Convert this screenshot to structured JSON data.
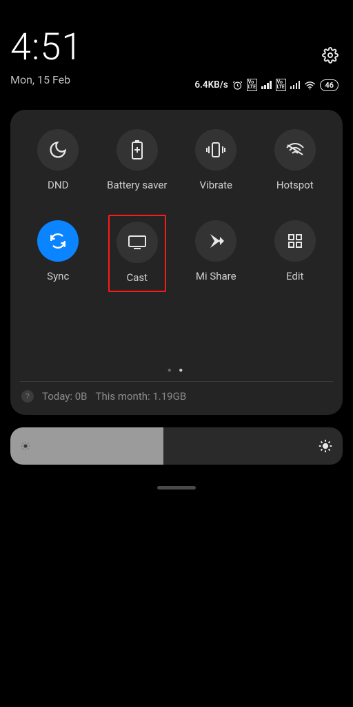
{
  "header": {
    "time": "4:51",
    "date": "Mon, 15 Feb"
  },
  "status": {
    "net_speed": "6.4KB/s",
    "battery": "46"
  },
  "tiles": [
    {
      "id": "dnd",
      "label": "DND",
      "active": false,
      "highlighted": false
    },
    {
      "id": "battery",
      "label": "Battery saver",
      "active": false,
      "highlighted": false
    },
    {
      "id": "vibrate",
      "label": "Vibrate",
      "active": false,
      "highlighted": false
    },
    {
      "id": "hotspot",
      "label": "Hotspot",
      "active": false,
      "highlighted": false
    },
    {
      "id": "sync",
      "label": "Sync",
      "active": true,
      "highlighted": false
    },
    {
      "id": "cast",
      "label": "Cast",
      "active": false,
      "highlighted": true
    },
    {
      "id": "mishare",
      "label": "Mi Share",
      "active": false,
      "highlighted": false
    },
    {
      "id": "edit",
      "label": "Edit",
      "active": false,
      "highlighted": false
    }
  ],
  "data_usage": {
    "today_label": "Today: 0B",
    "month_label": "This month: 1.19GB"
  }
}
